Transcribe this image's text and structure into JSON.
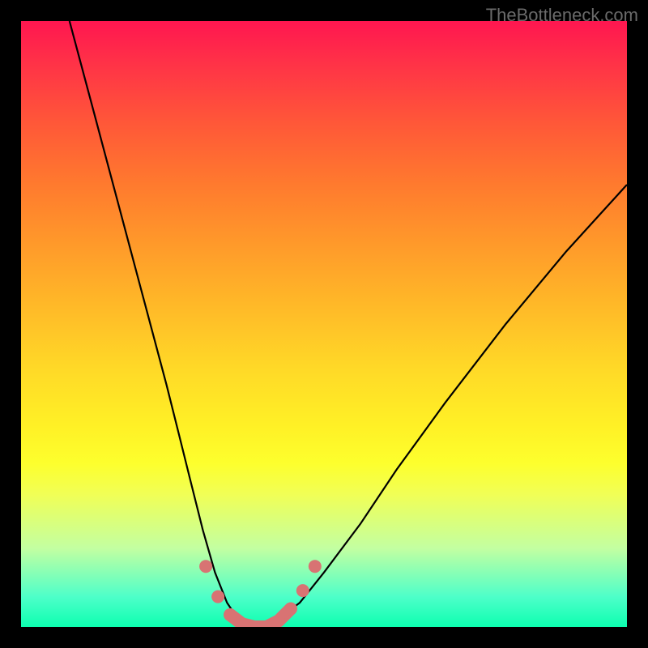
{
  "watermark": "TheBottleneck.com",
  "chart_data": {
    "type": "line",
    "title": "",
    "xlabel": "",
    "ylabel": "",
    "xlim": [
      0,
      100
    ],
    "ylim": [
      0,
      100
    ],
    "series": [
      {
        "name": "bottleneck-curve",
        "x": [
          8,
          12,
          16,
          20,
          24,
          26,
          28,
          30,
          32,
          34,
          36,
          38,
          40,
          42,
          46,
          50,
          56,
          62,
          70,
          80,
          90,
          100
        ],
        "y": [
          100,
          85,
          70,
          55,
          40,
          32,
          24,
          16,
          9,
          4,
          1,
          0,
          0,
          1,
          4,
          9,
          17,
          26,
          37,
          50,
          62,
          73
        ]
      }
    ],
    "highlight_points": {
      "name": "highlight-dots",
      "x": [
        30.5,
        32.5,
        34.5,
        36.5,
        38.5,
        40.5,
        42.5,
        44.5,
        46.5,
        48.5
      ],
      "y": [
        10,
        5,
        2,
        0.5,
        0,
        0,
        1,
        3,
        6,
        10
      ]
    },
    "colors": {
      "gradient_top": "#ff1650",
      "gradient_bottom": "#0dffb0",
      "curve": "#000000",
      "highlight": "#d87373"
    }
  }
}
